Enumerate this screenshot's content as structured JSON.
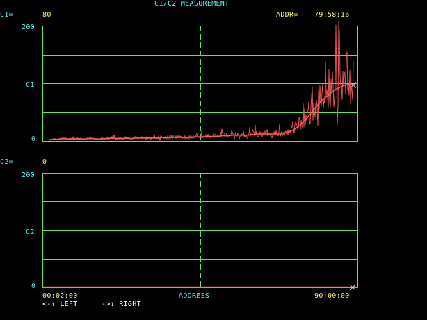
{
  "title": "C1/C2 MEASUREMENT",
  "colors": {
    "grid": "#5ee35e",
    "trace": "#ff5c5c",
    "label": "#5cf3f3",
    "value": "#f4f47c",
    "hint": "#ffffff"
  },
  "c1": {
    "label": "C1=",
    "value": "80",
    "ytop": "200",
    "ymid": "C1",
    "ybottom": "0"
  },
  "c2": {
    "label": "C2=",
    "value": "0",
    "ytop": "200",
    "ymid": "C2",
    "ybottom": "0"
  },
  "addr": {
    "label": "ADDR=",
    "value": "79:58:16"
  },
  "xaxis": {
    "start": "00:02:00",
    "label": "ADDRESS",
    "end": "90:00:00"
  },
  "hint": {
    "left": "<-↑ LEFT",
    "right": "->↓ RIGHT"
  },
  "chart_data": [
    {
      "type": "line",
      "title": "C1",
      "x_range": [
        "00:02:00",
        "90:00:00"
      ],
      "ylim": [
        0,
        200
      ],
      "grid": true,
      "series": [
        {
          "values": [
            2,
            3,
            3,
            4,
            3,
            3,
            4,
            3,
            4,
            4,
            3,
            4,
            4,
            5,
            4,
            4,
            5,
            4,
            5,
            5,
            5,
            5,
            5,
            6,
            5,
            6,
            6,
            6,
            6,
            6,
            7,
            7,
            7,
            8,
            8,
            8,
            9,
            9,
            10,
            10,
            10,
            10,
            11,
            12,
            12,
            12,
            12,
            12,
            12,
            14,
            17,
            21,
            28,
            36,
            46,
            56,
            66,
            74,
            80,
            88,
            92,
            96,
            98,
            97
          ]
        }
      ]
    },
    {
      "type": "line",
      "title": "C2",
      "x_range": [
        "00:02:00",
        "90:00:00"
      ],
      "ylim": [
        0,
        200
      ],
      "grid": true,
      "series": [
        {
          "values": [
            0,
            0
          ]
        }
      ]
    }
  ]
}
